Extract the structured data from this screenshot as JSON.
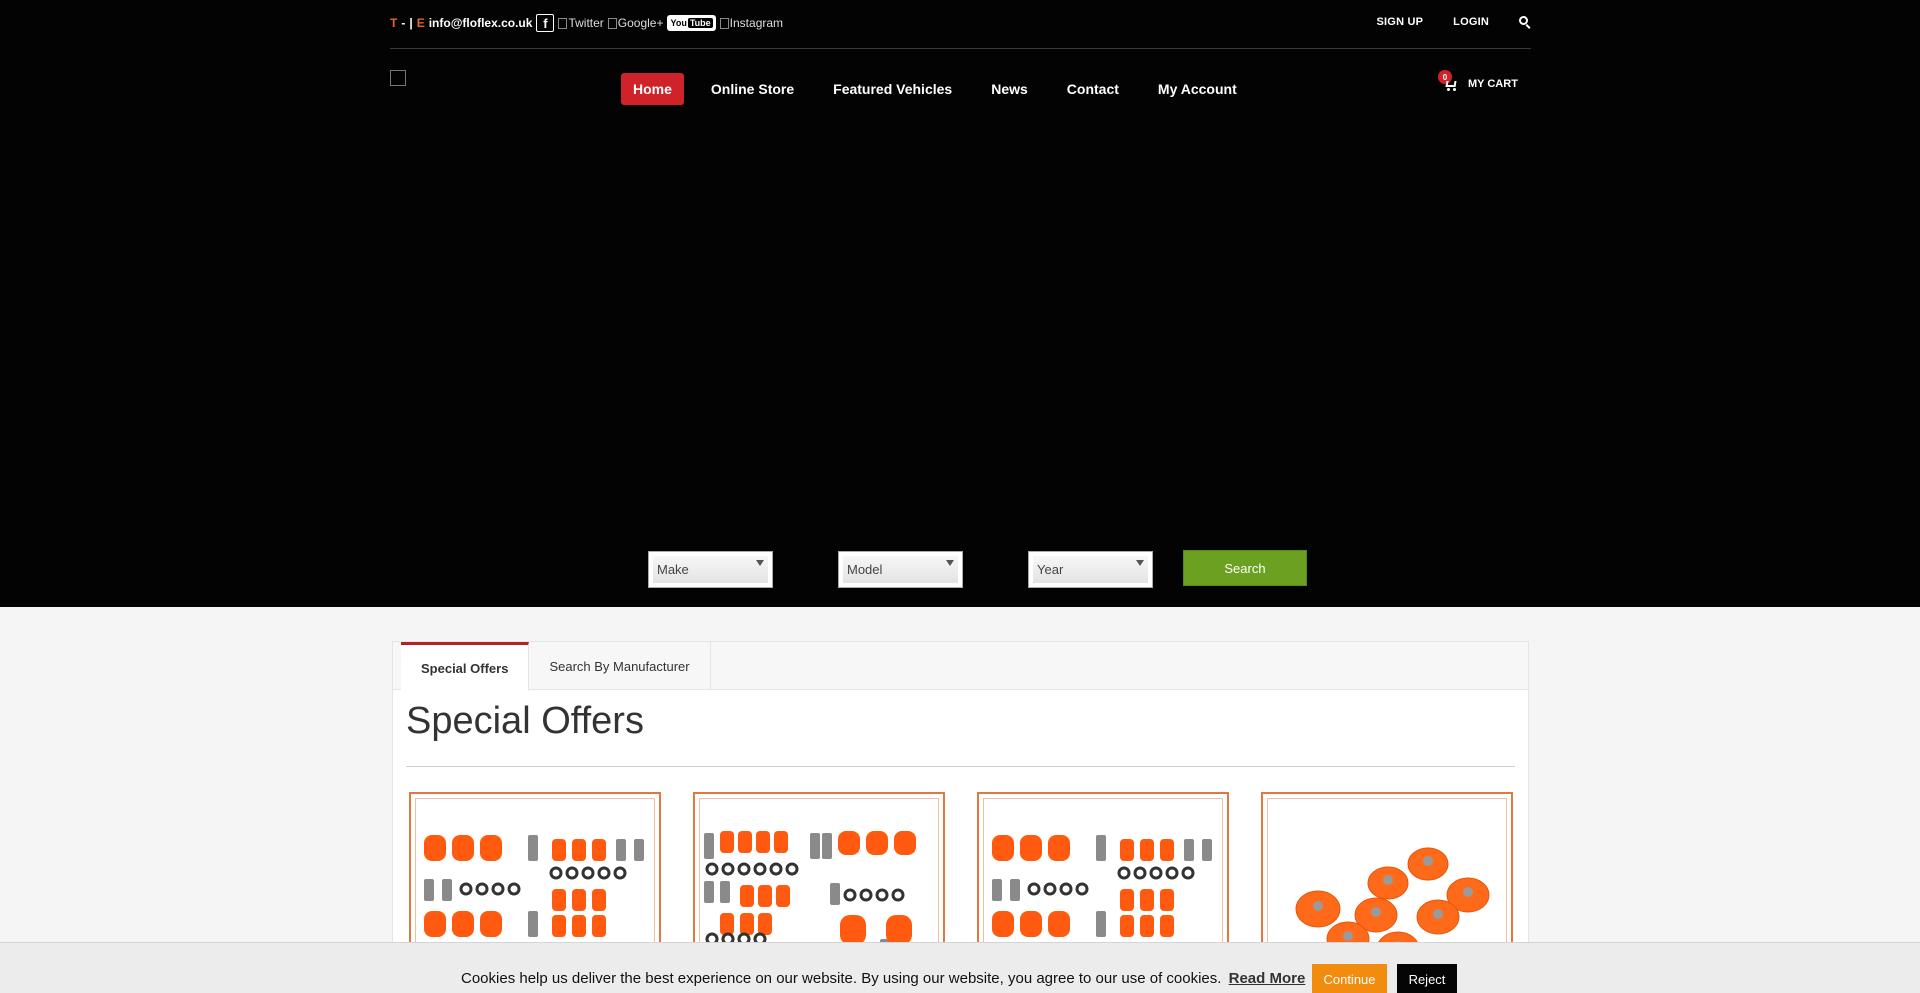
{
  "topbar": {
    "phone_prefix": "T",
    "sep1": "-",
    "sep2": "|",
    "email_prefix": "E",
    "email": "info@floflex.co.uk",
    "facebook_glyph": "f",
    "twitter_alt": "Twitter",
    "googleplus_alt": "Google+",
    "youtube_you": "You",
    "youtube_tube": "Tube",
    "instagram_alt": "Instagram",
    "signup": "SIGN UP",
    "login": "LOGIN",
    "search_icon": "search-icon"
  },
  "nav": {
    "items": [
      {
        "label": "Home",
        "active": true
      },
      {
        "label": "Online Store"
      },
      {
        "label": "Featured Vehicles"
      },
      {
        "label": "News"
      },
      {
        "label": "Contact"
      },
      {
        "label": "My Account"
      }
    ]
  },
  "cart": {
    "count": "0",
    "label": "MY CART",
    "icon": "cart-icon"
  },
  "filters": {
    "make": "Make",
    "model": "Model",
    "year": "Year",
    "search": "Search"
  },
  "tabs": [
    {
      "label": "Special Offers",
      "active": true
    },
    {
      "label": "Search By Manufacturer"
    }
  ],
  "section_title": "Special Offers",
  "products": [
    {
      "image": "bush-kit-1"
    },
    {
      "image": "bush-kit-2"
    },
    {
      "image": "bush-kit-3"
    },
    {
      "image": "bush-set-4"
    }
  ],
  "cookie": {
    "text": "Cookies help us deliver the best experience on our website. By using our website, you agree to our use of cookies.",
    "read_more": "Read More",
    "continue": "Continue",
    "reject": "Reject"
  },
  "colors": {
    "accent_red": "#d02229",
    "orange": "#e8642a",
    "search_green": "#6ba020",
    "continue_orange": "#f28c0f"
  }
}
